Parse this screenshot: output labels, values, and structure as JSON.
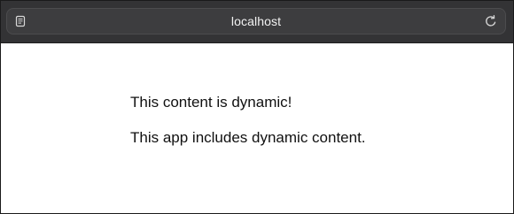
{
  "browser": {
    "url": "localhost",
    "icons": {
      "reader": "reader-view-icon",
      "reload": "reload-icon"
    },
    "colors": {
      "toolbar": "#333335",
      "address_bar": "#3d3d3f",
      "text": "#f2f2f2"
    }
  },
  "page": {
    "lines": [
      "This content is dynamic!",
      "This app includes dynamic content."
    ]
  }
}
